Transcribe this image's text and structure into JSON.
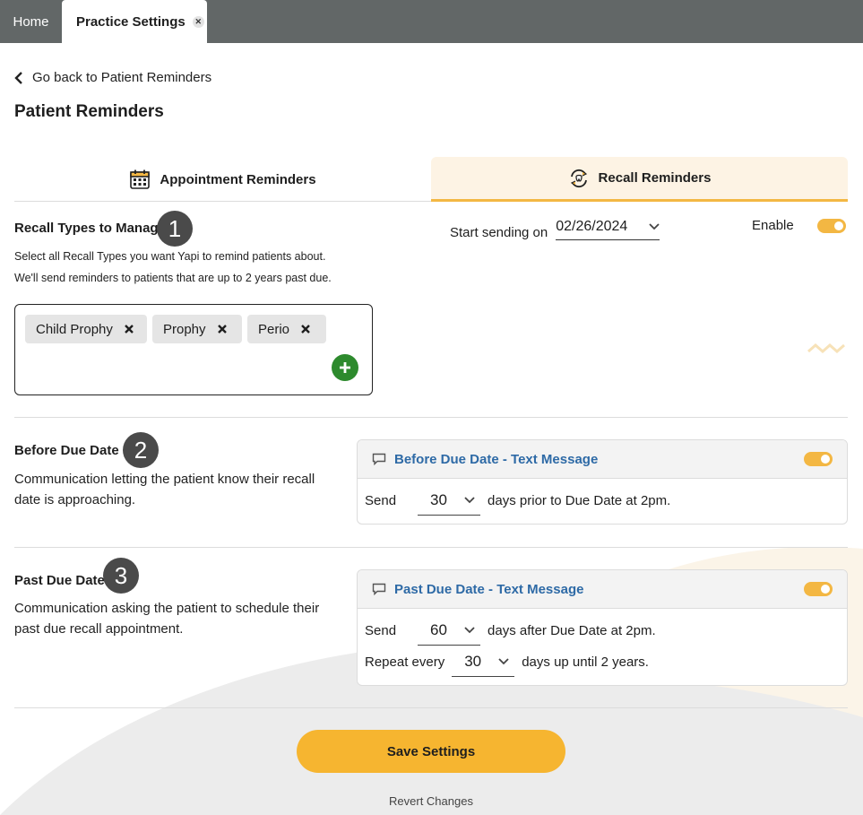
{
  "tabs": {
    "home": "Home",
    "active": "Practice Settings",
    "close_icon": "close-icon"
  },
  "back_link": "Go back to Patient Reminders",
  "page_title": "Patient Reminders",
  "segments": {
    "appointment": "Appointment Reminders",
    "recall": "Recall Reminders"
  },
  "section1": {
    "badge": "1",
    "title": "Recall Types to Manage",
    "desc_line1": "Select all Recall Types you want Yapi to remind patients about.",
    "desc_line2": "We'll send reminders to patients that are up to 2 years past due.",
    "chips": [
      "Child Prophy",
      "Prophy",
      "Perio"
    ]
  },
  "start_sending": {
    "label": "Start sending on",
    "date": "02/26/2024"
  },
  "enable_label": "Enable",
  "section2": {
    "badge": "2",
    "title": "Before Due Date",
    "desc_line1": "Communication letting the patient know their recall",
    "desc_line2": "date is approaching.",
    "card_title": "Before Due Date - Text Message",
    "send_label": "Send",
    "send_value": "30",
    "send_suffix": "days prior to Due Date at 2pm."
  },
  "section3": {
    "badge": "3",
    "title": "Past Due Date",
    "desc_line1": "Communication asking the patient to schedule their",
    "desc_line2": "past due recall appointment.",
    "card_title": "Past Due Date - Text Message",
    "send_label": "Send",
    "send_value": "60",
    "send_suffix": "days after Due Date at 2pm.",
    "repeat_label": "Repeat every",
    "repeat_value": "30",
    "repeat_suffix": "days up until 2 years."
  },
  "save_button": "Save Settings",
  "revert_link": "Revert Changes",
  "colors": {
    "accent": "#f3b743",
    "link": "#2e6aa6",
    "add": "#2d8a2d",
    "tabbar": "#626767"
  }
}
